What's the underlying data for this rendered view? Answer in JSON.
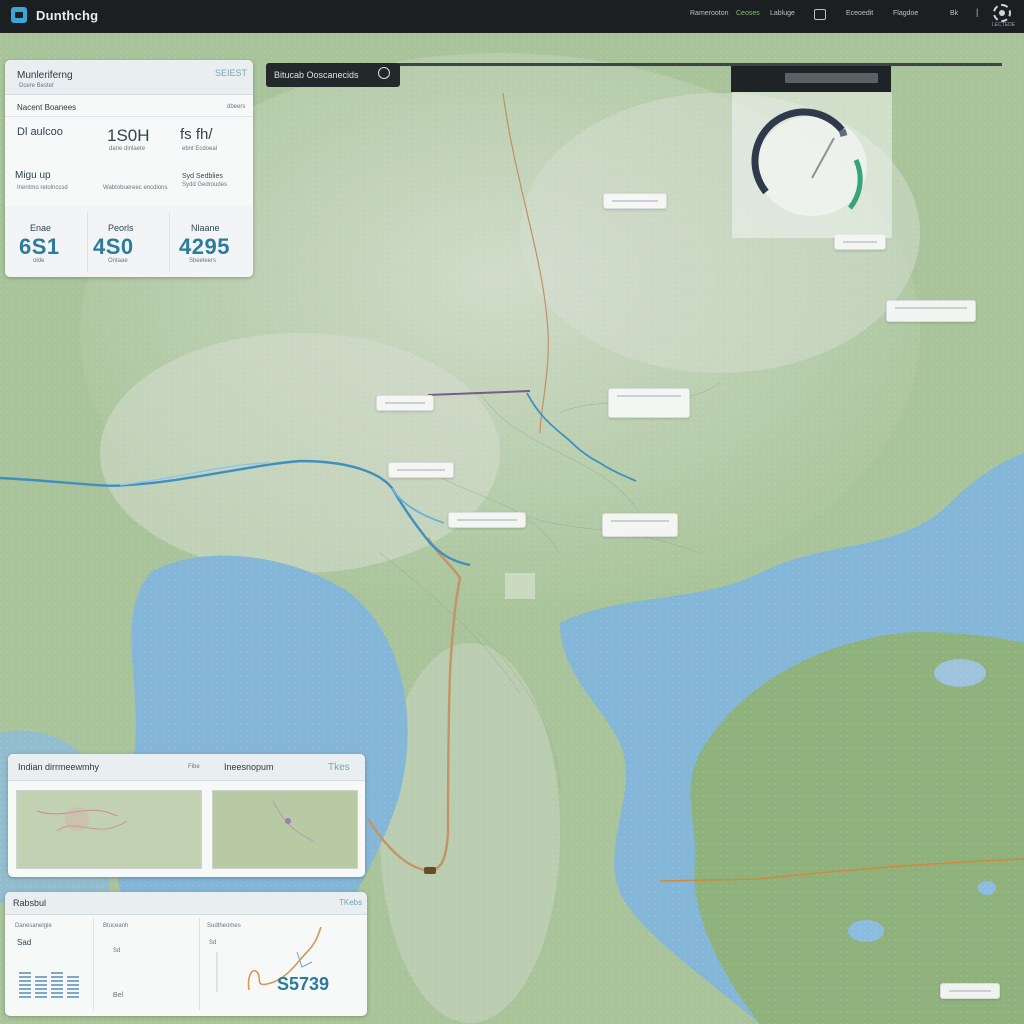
{
  "app": {
    "title": "Dunthchg"
  },
  "nav": {
    "items": [
      "Ramerooton",
      "Ceoses",
      "Labluge",
      "Eceoedit",
      "Flagdoe",
      "Bk"
    ],
    "settings_label": "LECTEDE"
  },
  "search": {
    "label": "Bitucab Ooscanecids"
  },
  "stats_panel": {
    "title": "Munleriferng",
    "subtitle": "Dcere Bestet",
    "badge": "SEIEST",
    "section_label": "Nacent Boanees",
    "section_meta": "dbeers",
    "cells": [
      {
        "value": "Dl aulcoo",
        "caption": ""
      },
      {
        "value": "1S0H",
        "caption": "dane dinlaete"
      },
      {
        "value": "fs fh/",
        "caption": "ebnt Ecdoeal"
      }
    ],
    "row2": [
      {
        "label": "Migu up",
        "caption": "Inentmo retolnccsd"
      },
      {
        "label": "",
        "caption": "Wabtobuereec encdions"
      },
      {
        "label": "Syd Sedblies",
        "caption": "Sydd Gedroudes"
      }
    ],
    "kpis": [
      {
        "label": "Enae",
        "value": "6S1",
        "caption": "olde"
      },
      {
        "label": "Peorls",
        "value": "4S0",
        "caption": "Ontaae"
      },
      {
        "label": "Nlaane",
        "value": "4295",
        "caption": "Sbeeleers"
      }
    ]
  },
  "minimap_panel": {
    "left_title": "Indian dirrmeewmhy",
    "left_meta": "Fibe",
    "right_title": "Ineesnopum",
    "right_meta": "Tkes"
  },
  "report_panel": {
    "title": "Rabsbul",
    "meta": "TKebs",
    "col1_header": "Danesanelgie",
    "col1_value": "Sad",
    "col2_header": "Btuceanh",
    "col2_value": "Sd",
    "col2_footer": "Bel",
    "col3_header": "Sudtheomes",
    "col3_value": "Sd",
    "total": "S5739"
  },
  "gauge": {
    "value_fraction": 0.62
  },
  "colors": {
    "land": "#a9c49a",
    "water": "#84b6d8",
    "river": "#3f8fbf",
    "road": "#c49464",
    "accent": "#2b7b9a",
    "topbar": "#1b1f22"
  }
}
